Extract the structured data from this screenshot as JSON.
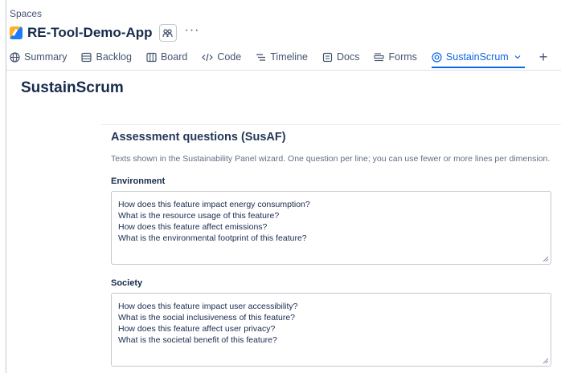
{
  "breadcrumb": "Spaces",
  "app": {
    "title": "RE-Tool-Demo-App",
    "more": "···"
  },
  "tabs": [
    {
      "label": "Summary",
      "icon": "globe-icon"
    },
    {
      "label": "Backlog",
      "icon": "backlog-icon"
    },
    {
      "label": "Board",
      "icon": "board-icon"
    },
    {
      "label": "Code",
      "icon": "code-icon"
    },
    {
      "label": "Timeline",
      "icon": "timeline-icon"
    },
    {
      "label": "Docs",
      "icon": "docs-icon"
    },
    {
      "label": "Forms",
      "icon": "forms-icon"
    },
    {
      "label": "SustainScrum",
      "icon": "sustainscrum-icon",
      "active": true
    }
  ],
  "add_tab": "+",
  "page": {
    "title": "SustainScrum"
  },
  "panel": {
    "title": "Assessment questions (SusAF)",
    "description": "Texts shown in the Sustainability Panel wizard. One question per line; you can use fewer or more lines per dimension.",
    "dimensions": [
      {
        "label": "Environment",
        "questions": [
          "How does this feature impact energy consumption?",
          "What is the resource usage of this feature?",
          "How does this feature affect emissions?",
          "What is the environmental footprint of this feature?"
        ]
      },
      {
        "label": "Society",
        "questions": [
          "How does this feature impact user accessibility?",
          "What is the social inclusiveness of this feature?",
          "How does this feature affect user privacy?",
          "What is the societal benefit of this feature?"
        ]
      }
    ]
  },
  "colors": {
    "accent": "#0c66e4",
    "text": "#172b4d",
    "muted": "#626f86",
    "border": "#c1c7d0"
  }
}
